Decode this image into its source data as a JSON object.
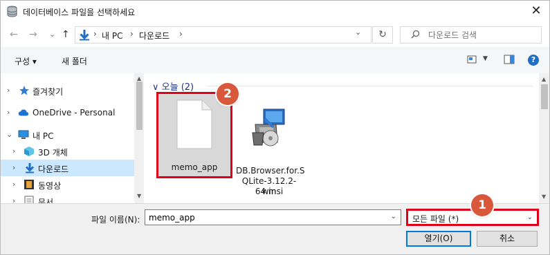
{
  "window": {
    "title": "데이터베이스 파일을 선택하세요",
    "close_glyph": "✕"
  },
  "nav": {
    "back_glyph": "←",
    "forward_glyph": "→",
    "history_glyph": "⌄",
    "up_glyph": "↑",
    "breadcrumbs": [
      {
        "label": "내 PC"
      },
      {
        "label": "다운로드"
      }
    ],
    "separator": "›",
    "refresh_glyph": "↻",
    "search_placeholder": "다운로드 검색"
  },
  "toolbar": {
    "organize": "구성 ▾",
    "new_folder": "새 폴더"
  },
  "sidebar": {
    "items": [
      {
        "label": "즐겨찾기",
        "icon": "star-icon",
        "chevron": "›"
      },
      {
        "label": "OneDrive - Personal",
        "icon": "cloud-icon",
        "chevron": "›"
      },
      {
        "label": "내 PC",
        "icon": "pc-icon",
        "chevron": "⌄"
      },
      {
        "label": "3D 개체",
        "icon": "cube-icon",
        "chevron": "›"
      },
      {
        "label": "다운로드",
        "icon": "download-arrow-icon",
        "chevron": "›"
      },
      {
        "label": "동영상",
        "icon": "film-icon",
        "chevron": "›"
      },
      {
        "label": "문서",
        "icon": "document-icon",
        "chevron": "›"
      }
    ]
  },
  "content": {
    "group_header": "∨ 오늘 (2)",
    "files": [
      {
        "name": "memo_app",
        "icon": "blank-file-icon",
        "selected": true
      },
      {
        "name": "DB.Browser.for.SQLite-3.12.2-win64.msi",
        "name_lines": [
          "DB.Browser.for.S",
          "QLite-3.12.2-win",
          "64.msi"
        ],
        "icon": "installer-package-icon"
      }
    ]
  },
  "annotations": {
    "badge_1": "1",
    "badge_2": "2",
    "highlight_color": "#e0001a",
    "badge_color": "#d9573a"
  },
  "bottom": {
    "filename_label": "파일 이름(N):",
    "filename_value": "memo_app",
    "filetype_value": "모든 파일 (*)",
    "open_button": "열기(O)",
    "cancel_button": "취소"
  },
  "colors": {
    "accent": "#0078d7",
    "selection": "#cce8ff",
    "group_header": "#1e3287"
  }
}
